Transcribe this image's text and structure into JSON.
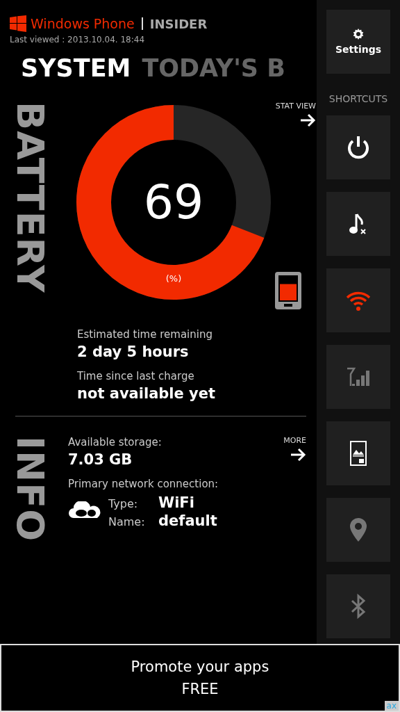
{
  "header": {
    "brand": "Windows Phone",
    "product": "INSIDER",
    "last_viewed": "Last viewed : 2013.10.04. 18:44"
  },
  "tabs": [
    {
      "label": "SYSTEM",
      "selected": true
    },
    {
      "label": "TODAY'S B",
      "selected": false
    }
  ],
  "battery": {
    "heading": "BATTERY",
    "link": "STAT VIEW",
    "value": "69",
    "unit": "(%)",
    "stats": [
      {
        "label": "Estimated time remaining",
        "value": "2 day 5 hours"
      },
      {
        "label": "Time since last charge",
        "value": "not available yet"
      }
    ]
  },
  "info": {
    "heading": "INFO",
    "link": "MORE",
    "storage_label": "Available storage:",
    "storage_value": "7.03 GB",
    "network_label": "Primary network connection:",
    "network": [
      {
        "label": "Type:",
        "value": "WiFi"
      },
      {
        "label": "Name:",
        "value": "default"
      }
    ]
  },
  "sidebar": {
    "settings": "Settings",
    "section": "SHORTCUTS",
    "shortcuts": [
      {
        "kind": "power",
        "on": true
      },
      {
        "kind": "ringer",
        "on": true
      },
      {
        "kind": "wifi",
        "on": true
      },
      {
        "kind": "cellular",
        "on": false
      },
      {
        "kind": "lockscreen",
        "on": true
      },
      {
        "kind": "location",
        "on": false
      },
      {
        "kind": "bluetooth",
        "on": false
      }
    ]
  },
  "ad": {
    "line1": "Promote your apps",
    "line2": "FREE",
    "badge": "ax"
  }
}
